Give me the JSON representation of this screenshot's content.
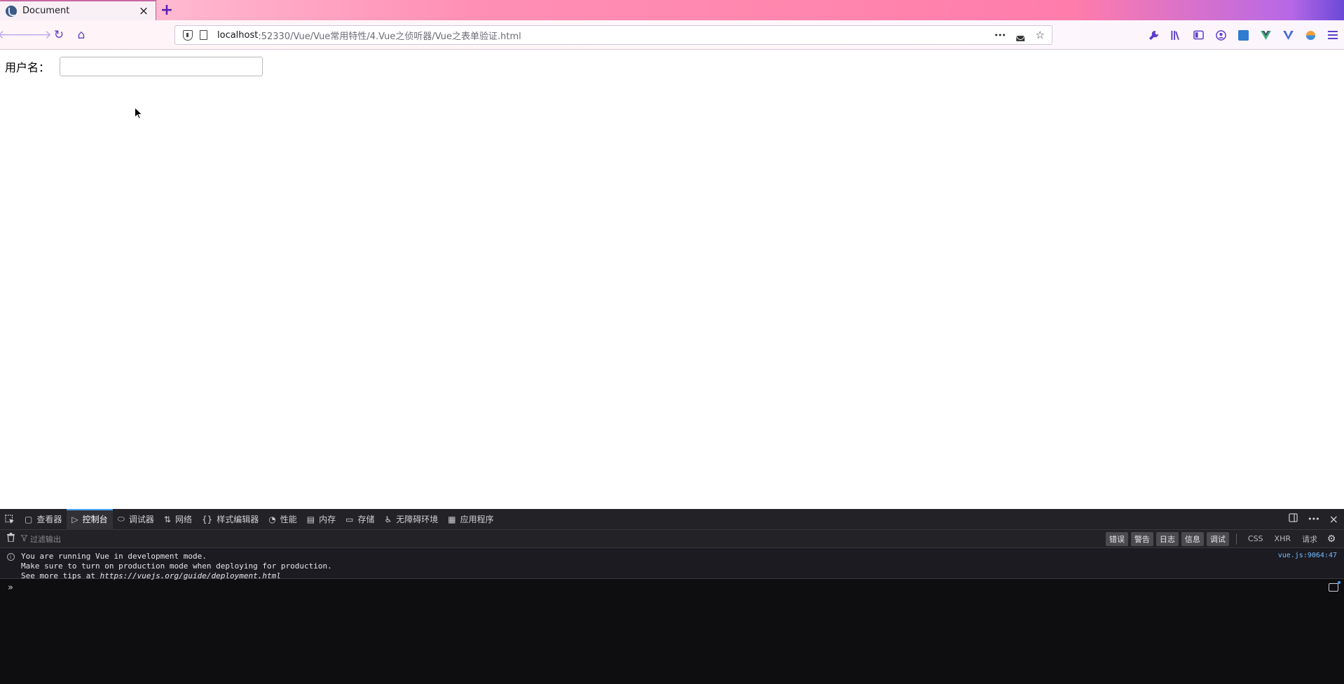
{
  "browser": {
    "tab": {
      "title": "Document",
      "close_icon": "×"
    },
    "new_tab_icon": "+",
    "url": {
      "host": "localhost",
      "path": ":52330/Vue/Vue常用特性/4.Vue之侦听器/Vue之表单验证.html"
    },
    "nav": {
      "back": "🡐",
      "forward": "🡒",
      "reload": "↻",
      "home": "⌂"
    },
    "url_actions": {
      "more": "•••",
      "pocket": "◛",
      "bookmark": "☆"
    }
  },
  "page": {
    "form": {
      "username_label": "用户名：",
      "username_value": "",
      "username_placeholder": ""
    }
  },
  "devtools": {
    "tabs": [
      {
        "icon": "▢",
        "label": "查看器"
      },
      {
        "icon": "▷",
        "label": "控制台"
      },
      {
        "icon": "⬭",
        "label": "调试器"
      },
      {
        "icon": "⇅",
        "label": "网络"
      },
      {
        "icon": "{}",
        "label": "样式编辑器"
      },
      {
        "icon": "◔",
        "label": "性能"
      },
      {
        "icon": "▤",
        "label": "内存"
      },
      {
        "icon": "▭",
        "label": "存储"
      },
      {
        "icon": "♿",
        "label": "无障碍环境"
      },
      {
        "icon": "▦",
        "label": "应用程序"
      }
    ],
    "filter_placeholder": "过滤输出",
    "levels": [
      "错误",
      "警告",
      "日志",
      "信息",
      "调试"
    ],
    "requests": [
      "CSS",
      "XHR",
      "请求"
    ],
    "message": {
      "line1": "You are running Vue in development mode.",
      "line2": "Make sure to turn on production mode when deploying for production.",
      "line3_prefix": "See more tips at ",
      "line3_link": "https://vuejs.org/guide/deployment.html",
      "source": "vue.js:9064:47"
    },
    "prompt": "»"
  },
  "colors": {
    "accent": "#5b3ec9",
    "devtools_active": "#45a1ff",
    "link": "#75bfff"
  }
}
